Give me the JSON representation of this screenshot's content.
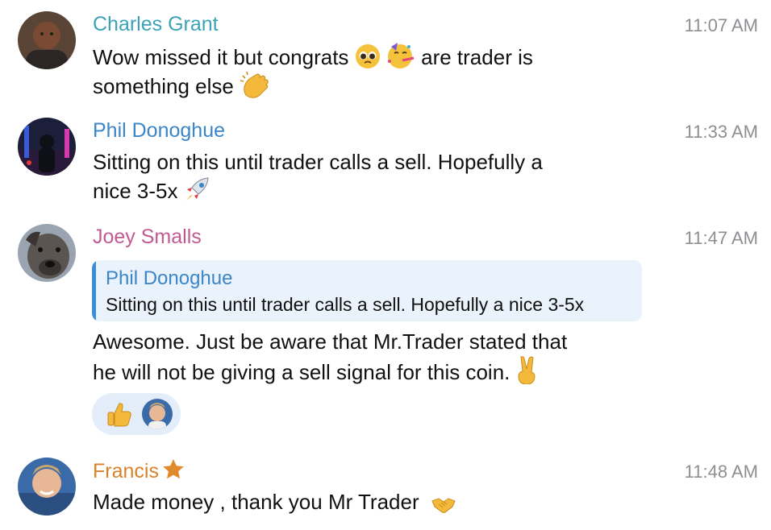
{
  "messages": [
    {
      "name": "Charles Grant",
      "name_color": "#3ba3b8",
      "time": "11:07 AM",
      "line1": "Wow missed it but congrats",
      "line1b": "are trader is",
      "line2": "something else",
      "emojis": [
        "pleading-face-icon",
        "partying-face-icon",
        "clapping-hands-icon"
      ]
    },
    {
      "name": "Phil Donoghue",
      "name_color": "#3a86c8",
      "time": "11:33 AM",
      "line1": "Sitting on this until trader calls a sell. Hopefully a",
      "line2": "nice 3-5x",
      "emojis": [
        "rocket-icon"
      ]
    },
    {
      "name": "Joey Smalls",
      "name_color": "#c25a92",
      "time": "11:47 AM",
      "reply": {
        "name": "Phil Donoghue",
        "text": "Sitting on this until trader calls a sell. Hopefully a nice 3-5x"
      },
      "line1": "Awesome.  Just be aware that Mr.Trader stated that",
      "line2": "he will not be giving a sell signal for this coin.",
      "emojis": [
        "victory-hand-icon"
      ],
      "reactions": [
        {
          "emoji": "thumbs-up-icon"
        }
      ]
    },
    {
      "name": "Francis",
      "name_color": "#d9822b",
      "time": "11:48 AM",
      "line1": "Made money , thank you Mr Trader",
      "emojis": [
        "handshake-icon"
      ],
      "badge": "star-icon"
    }
  ]
}
